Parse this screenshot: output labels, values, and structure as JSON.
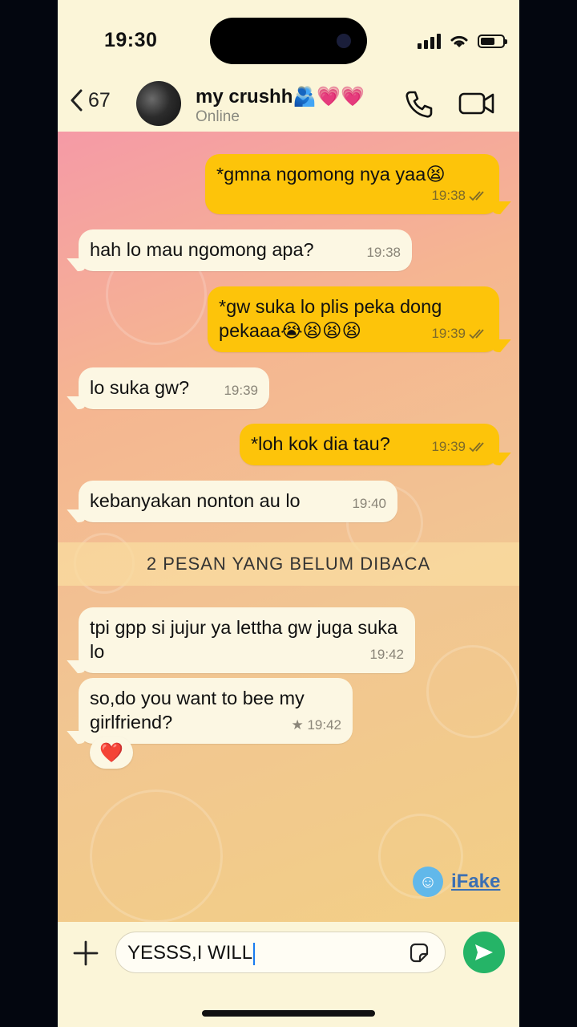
{
  "status_bar": {
    "time": "19:30"
  },
  "header": {
    "back_count": "67",
    "contact_name": "my crushh🫂💗💗",
    "contact_status": "Online"
  },
  "messages": [
    {
      "dir": "out",
      "text": "*gmna ngomong nya yaa😫",
      "time": "19:38",
      "read": true
    },
    {
      "dir": "in",
      "text": "hah lo mau ngomong apa?",
      "time": "19:38"
    },
    {
      "dir": "out",
      "text": "*gw suka lo plis peka dong pekaaa😭😫😫😫",
      "time": "19:39",
      "read": true
    },
    {
      "dir": "in",
      "text": "lo suka gw?",
      "time": "19:39"
    },
    {
      "dir": "out",
      "text": "*loh kok dia tau?",
      "time": "19:39",
      "read": true
    },
    {
      "dir": "in",
      "text": "kebanyakan nonton au lo",
      "time": "19:40"
    },
    {
      "dir": "in",
      "text": "tpi gpp si jujur ya lettha gw juga suka lo",
      "time": "19:42"
    },
    {
      "dir": "in",
      "text": "so,do you want to bee my girlfriend?",
      "time": "★ 19:42"
    }
  ],
  "unread_banner": "2 PESAN YANG BELUM DIBACA",
  "reaction": "❤️",
  "watermark": {
    "icon": "smile-icon",
    "text": "iFake"
  },
  "input": {
    "value": "YESSS,I WILL"
  },
  "colors": {
    "outgoing": "#fdc40a",
    "incoming": "#fcf7e3",
    "send": "#25b467"
  }
}
